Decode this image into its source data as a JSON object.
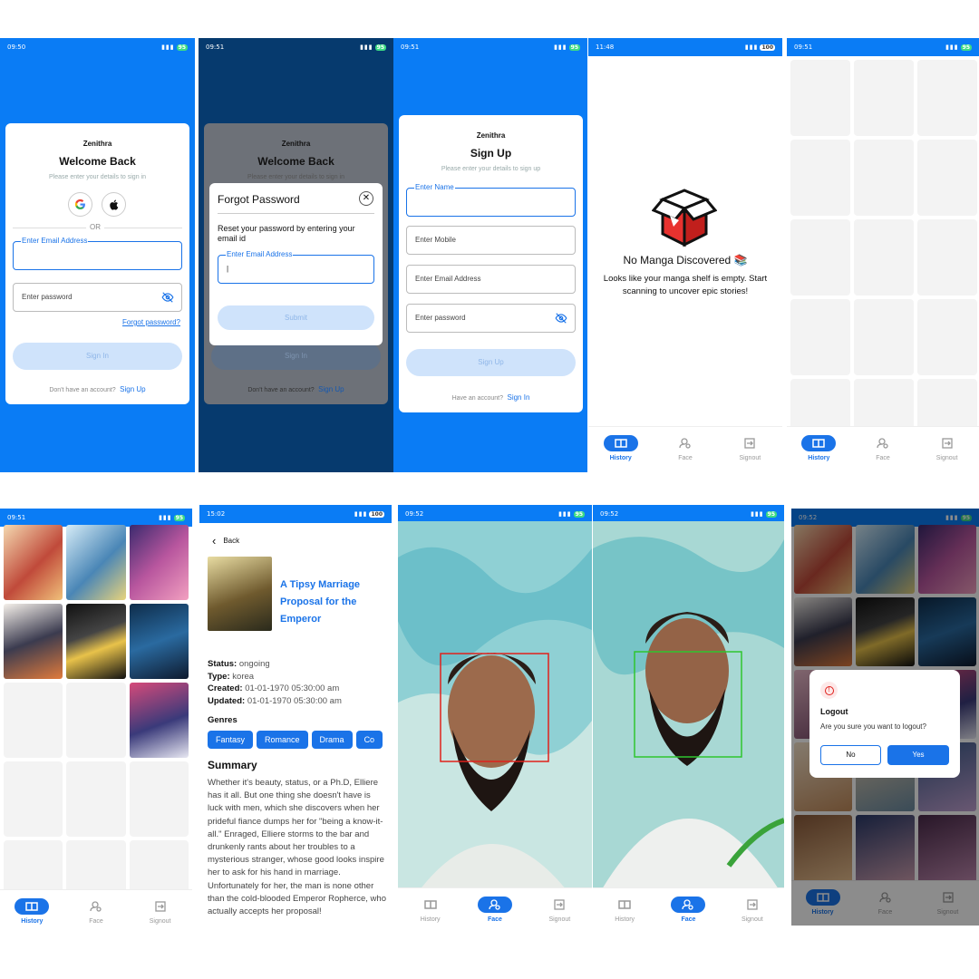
{
  "status": {
    "p1": "09:50",
    "p2": "09:51",
    "p3": "09:51",
    "p4": "11:48",
    "p5": "09:51",
    "p6": "09:51",
    "p7": "15:02",
    "p8": "09:52",
    "p9": "09:52",
    "p10": "09:52",
    "battery": "95",
    "battery_full": "100"
  },
  "signin": {
    "brand": "Zenithra",
    "title": "Welcome Back",
    "subtitle": "Please enter your details to sign in",
    "or": "OR",
    "email_label": "Enter Email Address",
    "password_placeholder": "Enter password",
    "forgot": "Forgot password?",
    "button": "Sign In",
    "no_account": "Don't have an account?",
    "signup_link": "Sign Up"
  },
  "forgot": {
    "title": "Forgot Password",
    "desc": "Reset your password by entering your email id",
    "email_label": "Enter Email Address",
    "button": "Submit"
  },
  "signup": {
    "brand": "Zenithra",
    "title": "Sign Up",
    "subtitle": "Please enter your details to sign up",
    "name_label": "Enter Name",
    "mobile": "Enter Mobile",
    "email": "Enter Email Address",
    "password": "Enter password",
    "button": "Sign Up",
    "have_account": "Have an account?",
    "signin_link": "Sign In"
  },
  "empty": {
    "title": "No Manga Discovered 📚",
    "desc": "Looks like your manga shelf is empty. Start scanning to uncover epic stories!"
  },
  "tabs": {
    "history": "History",
    "face": "Face",
    "signout": "Signout"
  },
  "detail": {
    "back": "Back",
    "title": "A Tipsy Marriage Proposal for the Emperor",
    "status_label": "Status:",
    "status": "ongoing",
    "type_label": "Type:",
    "type": "korea",
    "created_label": "Created:",
    "created": "01-01-1970 05:30:00 am",
    "updated_label": "Updated:",
    "updated": "01-01-1970 05:30:00 am",
    "genres_label": "Genres",
    "genres": [
      "Fantasy",
      "Romance",
      "Drama",
      "Co"
    ],
    "summary_label": "Summary",
    "summary": "Whether it's beauty, status, or a Ph.D, Elliere has it all. But one thing she doesn't have is luck with men, which she discovers when her prideful fiance dumps her for \"being a know-it-all.\" Enraged, Elliere storms to the bar and drunkenly rants about her troubles to a mysterious stranger, whose good looks inspire her to ask for his hand in marriage. Unfortunately for her, the man is none other than the cold-blooded Emperor Ropherce, who actually accepts her proposal!"
  },
  "logout": {
    "title": "Logout",
    "question": "Are you sure you want to logout?",
    "no": "No",
    "yes": "Yes"
  },
  "colors": {
    "primary": "#1a73e8",
    "bg_blue": "#0a7cf5",
    "dim_blue": "#063a6e",
    "face_red": "#e0201b",
    "face_green": "#2fc52f"
  }
}
